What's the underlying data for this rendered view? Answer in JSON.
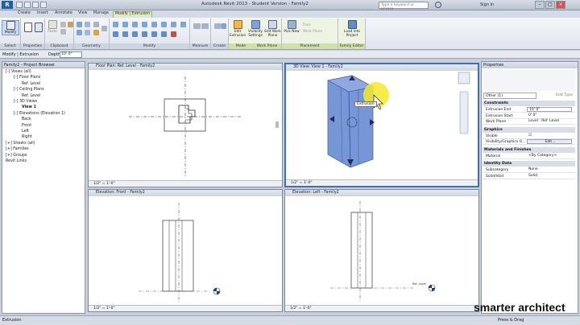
{
  "titlebar": {
    "title": "Autodesk Revit 2013 - Student Version -   Family2",
    "search_placeholder": "Type a keyword or phrase",
    "signin": "Sign In"
  },
  "tabs": [
    "Create",
    "Insert",
    "Annotate",
    "View",
    "Manage",
    "Modify | Extrusion"
  ],
  "ribbon": {
    "groups": [
      {
        "label": "Select",
        "buttons": [
          "Modify"
        ]
      },
      {
        "label": "Properties",
        "buttons": []
      },
      {
        "label": "Clipboard",
        "buttons": [
          "Paste",
          "Cut",
          "Copy"
        ]
      },
      {
        "label": "Geometry",
        "buttons": [
          "Cope",
          "Join",
          "Cut"
        ]
      },
      {
        "label": "Modify",
        "buttons": []
      },
      {
        "label": "Measure",
        "buttons": []
      },
      {
        "label": "Create",
        "buttons": []
      },
      {
        "label": "Mode",
        "buttons": [
          "Edit Extrusion",
          "Visibility Settings",
          "Edit Work Plane"
        ]
      },
      {
        "label": "Work Plane",
        "buttons": []
      },
      {
        "label": "Placement",
        "buttons": [
          "Pick New",
          "Face",
          "Work Plane"
        ]
      },
      {
        "label": "Family Editor",
        "buttons": [
          "Load into Project"
        ]
      }
    ]
  },
  "optbar": {
    "mode": "Modify | Extrusion",
    "depth_label": "Depth",
    "depth_value": "10'  0\""
  },
  "browser": {
    "title": "Family2 - Project Browser",
    "items": [
      {
        "text": "Views (all)",
        "depth": 0,
        "toggle": "-"
      },
      {
        "text": "Floor Plans",
        "depth": 1,
        "toggle": "-"
      },
      {
        "text": "Ref. Level",
        "depth": 2,
        "toggle": ""
      },
      {
        "text": "Ceiling Plans",
        "depth": 1,
        "toggle": "-"
      },
      {
        "text": "Ref. Level",
        "depth": 2,
        "toggle": ""
      },
      {
        "text": "3D Views",
        "depth": 1,
        "toggle": "-"
      },
      {
        "text": "View 1",
        "depth": 2,
        "toggle": "",
        "bold": true
      },
      {
        "text": "Elevations (Elevation 1)",
        "depth": 1,
        "toggle": "-"
      },
      {
        "text": "Back",
        "depth": 2,
        "toggle": ""
      },
      {
        "text": "Front",
        "depth": 2,
        "toggle": ""
      },
      {
        "text": "Left",
        "depth": 2,
        "toggle": ""
      },
      {
        "text": "Right",
        "depth": 2,
        "toggle": ""
      },
      {
        "text": "Sheets (all)",
        "depth": 0,
        "toggle": "+"
      },
      {
        "text": "Families",
        "depth": 0,
        "toggle": "+"
      },
      {
        "text": "Groups",
        "depth": 0,
        "toggle": "+"
      },
      {
        "text": "Revit Links",
        "depth": 0,
        "toggle": ""
      }
    ]
  },
  "views": {
    "floor": {
      "title": "Floor Plan: Ref. Level - Family2",
      "scale": "1/2\" = 1'-0\""
    },
    "view3d": {
      "title": "3D View: View 1 - Family2",
      "scale": "1/2\" = 1'-0\"",
      "tooltip": "Extrusion"
    },
    "front": {
      "title": "Elevation: Front - Family2",
      "scale": "1/2\" = 1'-0\""
    },
    "left": {
      "title": "Elevation: Left - Family2",
      "scale": "1/2\" = 1'-0\"",
      "level_tag": "Ref. Level"
    }
  },
  "properties": {
    "title": "Properties",
    "type_selector": "Other (1)",
    "edit_type": "Edit Type",
    "sections": [
      {
        "name": "Constraints",
        "rows": [
          {
            "k": "Extrusion End",
            "v": "10'  0\"",
            "style": "box"
          },
          {
            "k": "Extrusion Start",
            "v": "0'  0\"",
            "style": "plain"
          },
          {
            "k": "Work Plane",
            "v": "Level : Ref. Level",
            "style": "plain"
          }
        ]
      },
      {
        "name": "Graphics",
        "rows": [
          {
            "k": "Visible",
            "v": "☑",
            "style": "plain"
          },
          {
            "k": "Visibility/Graphics O...",
            "v": "Edit...",
            "style": "btn"
          }
        ]
      },
      {
        "name": "Materials and Finishes",
        "rows": [
          {
            "k": "Material",
            "v": "<By Category>",
            "style": "plain"
          }
        ]
      },
      {
        "name": "Identity Data",
        "rows": [
          {
            "k": "Subcategory",
            "v": "None",
            "style": "plain"
          },
          {
            "k": "Solid/Void",
            "v": "Solid",
            "style": "plain"
          }
        ]
      }
    ]
  },
  "status": {
    "left": "Extrusion",
    "press_drag": "Press & Drag"
  },
  "brand": "smarter architect"
}
